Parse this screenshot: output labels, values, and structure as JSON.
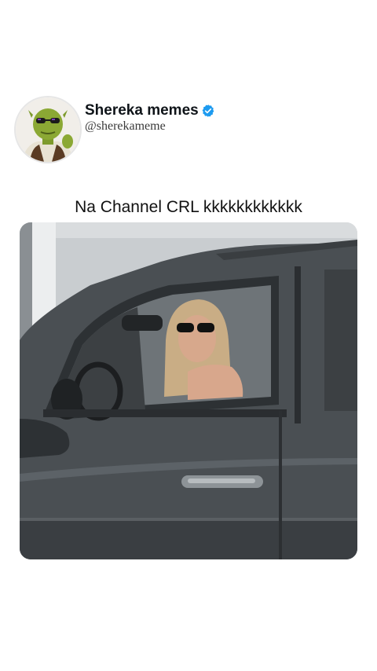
{
  "post": {
    "author": {
      "display_name": "Shereka memes",
      "handle": "@sherekameme",
      "verified": true,
      "avatar_icon": "shrek-sunglasses-avatar-icon",
      "verified_color": "#1d9bf0"
    },
    "caption": "Na Channel CRL kkkkkkkkkkkk",
    "media": {
      "kind": "video-frame",
      "icon": "woman-in-car-photo"
    }
  }
}
